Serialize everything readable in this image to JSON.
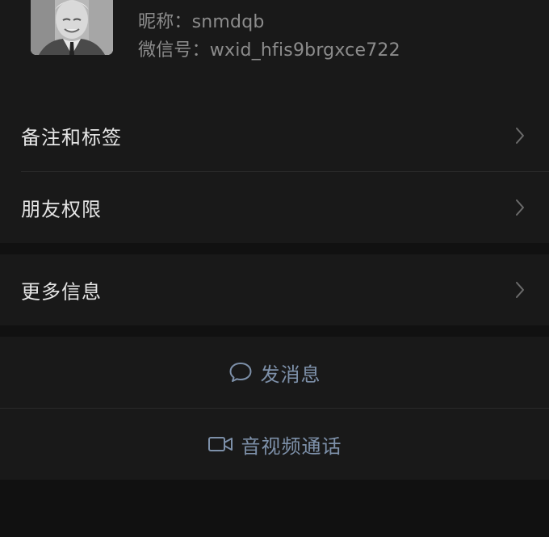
{
  "profile": {
    "nickname": "昵称：snmdqb",
    "wechat_id": "微信号：wxid_hfis9brgxce722"
  },
  "settings": {
    "remark_tags": "备注和标签",
    "friend_permissions": "朋友权限",
    "more_info": "更多信息"
  },
  "actions": {
    "send_message": "发消息",
    "video_call": "音视频通话"
  },
  "icons": {
    "avatar": "profile-photo",
    "chevron": "chevron-right-icon",
    "message": "chat-bubble-icon",
    "video": "video-camera-icon"
  },
  "colors": {
    "background": "#111111",
    "card": "#191919",
    "primary_text": "#e5e5e5",
    "secondary_text": "#8c8c8c",
    "link_text": "#7d90a9"
  }
}
